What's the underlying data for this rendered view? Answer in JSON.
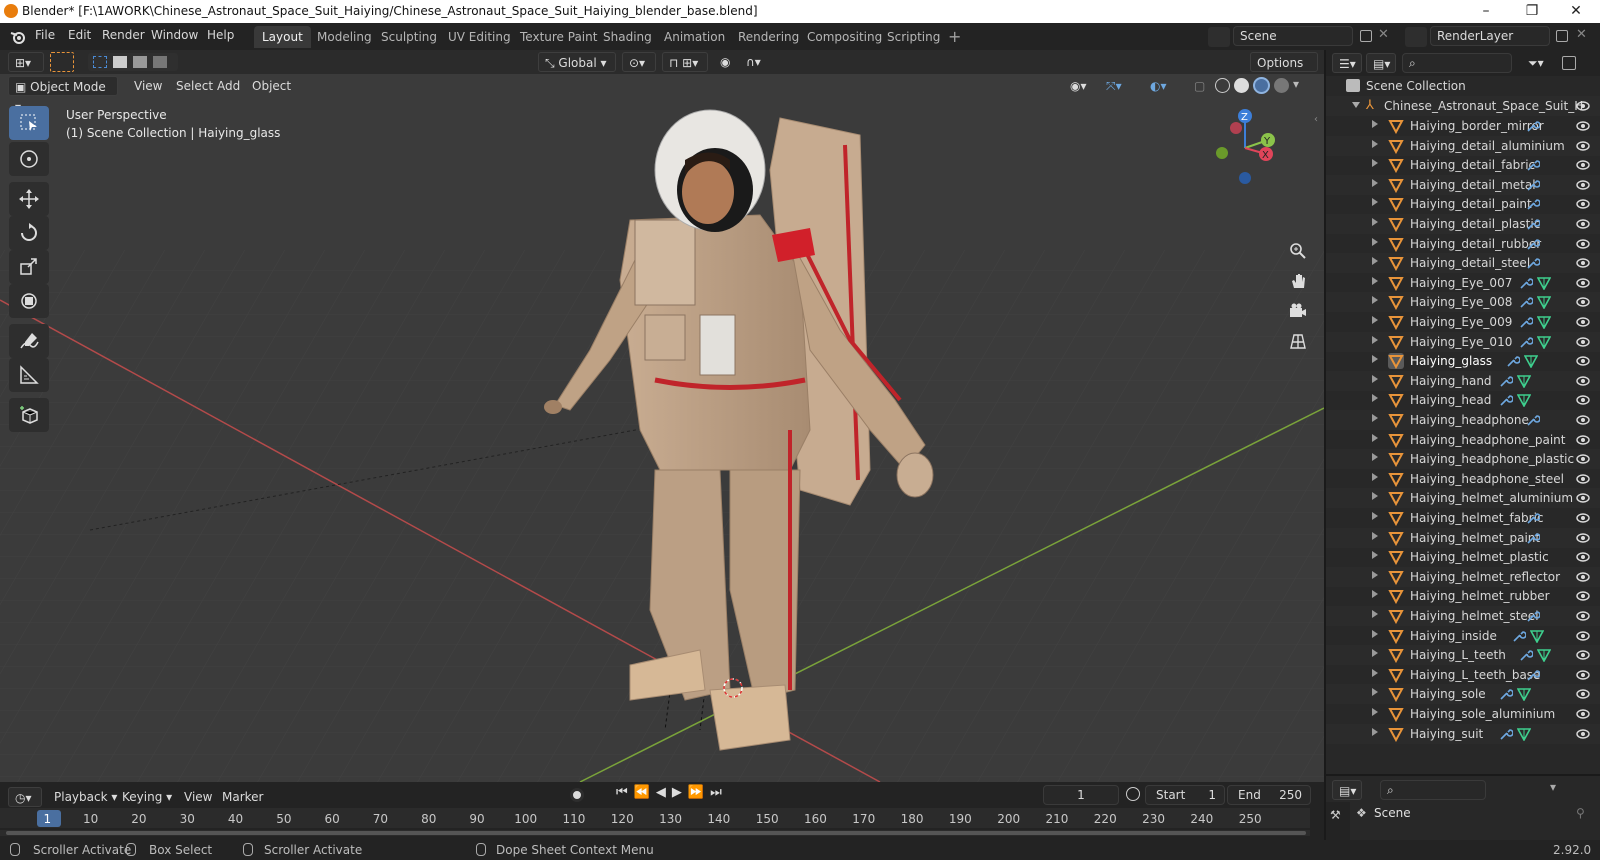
{
  "window": {
    "title": "Blender* [F:\\1AWORK\\Chinese_Astronaut_Space_Suit_Haiying/Chinese_Astronaut_Space_Suit_Haiying_blender_base.blend]",
    "minimize": "–",
    "maximize": "❐",
    "close": "✕"
  },
  "menus": [
    "File",
    "Edit",
    "Render",
    "Window",
    "Help"
  ],
  "workspaces": [
    "Layout",
    "Modeling",
    "Sculpting",
    "UV Editing",
    "Texture Paint",
    "Shading",
    "Animation",
    "Rendering",
    "Compositing",
    "Scripting"
  ],
  "active_workspace": "Layout",
  "scene_name": "Scene",
  "render_layer": "RenderLayer",
  "viewport": {
    "mode": "Object Mode",
    "menu": [
      "View",
      "Select",
      "Add",
      "Object"
    ],
    "orientation": "Global",
    "options_label": "Options",
    "overlay_line1": "User Perspective",
    "overlay_line2": "(1) Scene Collection | Haiying_glass",
    "gizmo": {
      "z": "Z",
      "y": "Y",
      "x": "X"
    }
  },
  "timeline": {
    "menu": [
      "Playback",
      "Keying",
      "View",
      "Marker"
    ],
    "current_frame": "1",
    "start_label": "Start",
    "start": "1",
    "end_label": "End",
    "end": "250",
    "ticks": [
      "1",
      "10",
      "20",
      "30",
      "40",
      "50",
      "60",
      "70",
      "80",
      "90",
      "100",
      "110",
      "120",
      "130",
      "140",
      "150",
      "160",
      "170",
      "180",
      "190",
      "200",
      "210",
      "220",
      "230",
      "240",
      "250"
    ]
  },
  "outliner": {
    "root": "Scene Collection",
    "collection": "Chinese_Astronaut_Space_Suit_H",
    "items": [
      {
        "name": "Haiying_border_mirror",
        "mod": true,
        "mesh": false
      },
      {
        "name": "Haiying_detail_aluminium",
        "mod": false,
        "mesh": false
      },
      {
        "name": "Haiying_detail_fabric",
        "mod": true,
        "mesh": false
      },
      {
        "name": "Haiying_detail_metal",
        "mod": true,
        "mesh": false
      },
      {
        "name": "Haiying_detail_paint",
        "mod": true,
        "mesh": false
      },
      {
        "name": "Haiying_detail_plastic",
        "mod": true,
        "mesh": false
      },
      {
        "name": "Haiying_detail_rubber",
        "mod": true,
        "mesh": false
      },
      {
        "name": "Haiying_detail_steel",
        "mod": true,
        "mesh": false
      },
      {
        "name": "Haiying_Eye_007",
        "mod": true,
        "mesh": true
      },
      {
        "name": "Haiying_Eye_008",
        "mod": true,
        "mesh": true
      },
      {
        "name": "Haiying_Eye_009",
        "mod": true,
        "mesh": true
      },
      {
        "name": "Haiying_Eye_010",
        "mod": true,
        "mesh": true
      },
      {
        "name": "Haiying_glass",
        "mod": true,
        "mesh": true
      },
      {
        "name": "Haiying_hand",
        "mod": true,
        "mesh": true
      },
      {
        "name": "Haiying_head",
        "mod": true,
        "mesh": true
      },
      {
        "name": "Haiying_headphone",
        "mod": true,
        "mesh": false
      },
      {
        "name": "Haiying_headphone_paint",
        "mod": false,
        "mesh": false
      },
      {
        "name": "Haiying_headphone_plastic",
        "mod": false,
        "mesh": false
      },
      {
        "name": "Haiying_headphone_steel",
        "mod": false,
        "mesh": false
      },
      {
        "name": "Haiying_helmet_aluminium",
        "mod": false,
        "mesh": false
      },
      {
        "name": "Haiying_helmet_fabric",
        "mod": true,
        "mesh": false
      },
      {
        "name": "Haiying_helmet_paint",
        "mod": true,
        "mesh": false
      },
      {
        "name": "Haiying_helmet_plastic",
        "mod": false,
        "mesh": false
      },
      {
        "name": "Haiying_helmet_reflector",
        "mod": false,
        "mesh": false
      },
      {
        "name": "Haiying_helmet_rubber",
        "mod": false,
        "mesh": false
      },
      {
        "name": "Haiying_helmet_steel",
        "mod": true,
        "mesh": false
      },
      {
        "name": "Haiying_inside",
        "mod": true,
        "mesh": true
      },
      {
        "name": "Haiying_L_teeth",
        "mod": true,
        "mesh": true
      },
      {
        "name": "Haiying_L_teeth_base",
        "mod": true,
        "mesh": false
      },
      {
        "name": "Haiying_sole",
        "mod": true,
        "mesh": true
      },
      {
        "name": "Haiying_sole_aluminium",
        "mod": false,
        "mesh": false
      },
      {
        "name": "Haiying_suit",
        "mod": true,
        "mesh": true
      }
    ]
  },
  "properties": {
    "scene_label": "Scene"
  },
  "status": {
    "left1": "Scroller Activate",
    "left2": "Box Select",
    "left3": "Scroller Activate",
    "mid": "Dope Sheet Context Menu",
    "version": "2.92.0"
  },
  "colors": {
    "accent": "#4a6fa0",
    "object_orange": "#e8943a",
    "grid_x": "#b34a4a",
    "grid_y": "#7aa33a"
  }
}
